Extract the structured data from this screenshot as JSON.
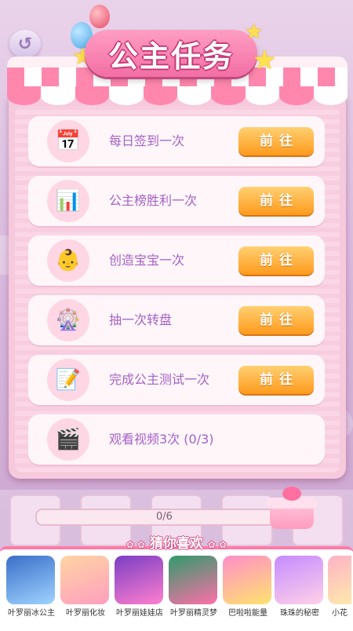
{
  "header": {
    "title": "公主任务",
    "back_icon": "back-arrow-icon"
  },
  "tasks": [
    {
      "label": "每日签到一次",
      "button": "前往",
      "icon": "calendar-icon"
    },
    {
      "label": "公主榜胜利一次",
      "button": "前往",
      "icon": "podium-icon"
    },
    {
      "label": "创造宝宝一次",
      "button": "前往",
      "icon": "baby-icon"
    },
    {
      "label": "抽一次转盘",
      "button": "前往",
      "icon": "wheel-icon"
    },
    {
      "label": "完成公主测试一次",
      "button": "前往",
      "icon": "quiz-paper-icon"
    },
    {
      "label": "观看视频3次 (0/3)",
      "button": "",
      "icon": "video-clapper-icon"
    }
  ],
  "progress": {
    "text": "0/6",
    "value": 0
  },
  "recommend": {
    "title": "猜你喜欢",
    "games": [
      {
        "name": "叶罗丽冰公主"
      },
      {
        "name": "叶罗丽化妆"
      },
      {
        "name": "叶罗丽娃娃店"
      },
      {
        "name": "叶罗丽精灵梦"
      },
      {
        "name": "巴啦啦能量"
      },
      {
        "name": "珠珠的秘密"
      },
      {
        "name": "小花"
      }
    ]
  },
  "colors": {
    "accent_pink": "#ff87ad",
    "button_orange": "#ff9a1d",
    "task_text": "#a461c6"
  }
}
